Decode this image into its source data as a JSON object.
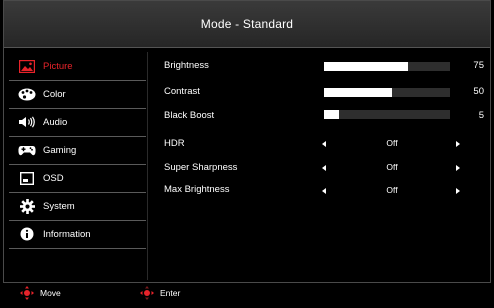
{
  "header": {
    "title": "Mode - Standard"
  },
  "sidebar": {
    "items": [
      {
        "label": "Picture",
        "icon": "picture-icon",
        "active": true
      },
      {
        "label": "Color",
        "icon": "palette-icon",
        "active": false
      },
      {
        "label": "Audio",
        "icon": "speaker-icon",
        "active": false
      },
      {
        "label": "Gaming",
        "icon": "gamepad-icon",
        "active": false
      },
      {
        "label": "OSD",
        "icon": "osd-window-icon",
        "active": false
      },
      {
        "label": "System",
        "icon": "gear-icon",
        "active": false
      },
      {
        "label": "Information",
        "icon": "info-icon",
        "active": false
      }
    ]
  },
  "settings": {
    "brightness": {
      "label": "Brightness",
      "value": "75",
      "level": 0.67
    },
    "contrast": {
      "label": "Contrast",
      "value": "50",
      "level": 0.54
    },
    "black_boost": {
      "label": "Black Boost",
      "value": "5",
      "level": 0.12
    },
    "hdr": {
      "label": "HDR",
      "value": "Off"
    },
    "super_sharpness": {
      "label": "Super Sharpness",
      "value": "Off"
    },
    "max_brightness": {
      "label": "Max Brightness",
      "value": "Off"
    }
  },
  "footer": {
    "move_label": "Move",
    "enter_label": "Enter"
  },
  "colors": {
    "accent": "#e8232a",
    "background": "#000000",
    "text": "#ffffff",
    "track": "#2e2e2e"
  }
}
